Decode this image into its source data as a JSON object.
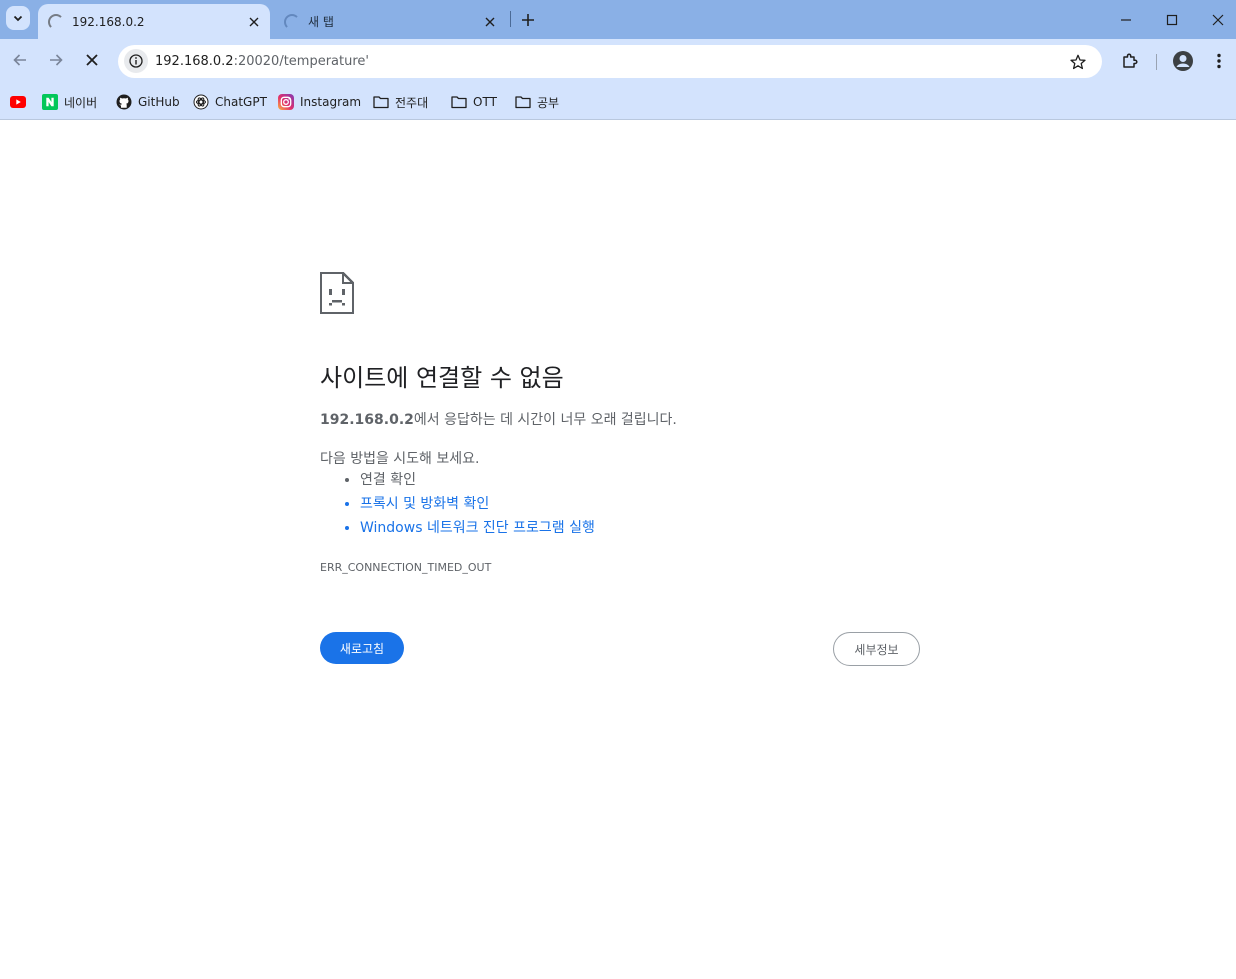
{
  "tabs": [
    {
      "title": "192.168.0.2",
      "active": true
    },
    {
      "title": "새 탭",
      "active": false
    }
  ],
  "toolbar": {
    "url_host": "192.168.0.2",
    "url_rest": ":20020/temperature'"
  },
  "bookmarks": [
    {
      "label": "",
      "icon": "youtube-icon"
    },
    {
      "label": "네이버",
      "icon": "naver-icon"
    },
    {
      "label": "GitHub",
      "icon": "github-icon"
    },
    {
      "label": "ChatGPT",
      "icon": "chatgpt-icon"
    },
    {
      "label": "Instagram",
      "icon": "instagram-icon"
    },
    {
      "label": "전주대",
      "icon": "folder-icon"
    },
    {
      "label": "OTT",
      "icon": "folder-icon"
    },
    {
      "label": "공부",
      "icon": "folder-icon"
    }
  ],
  "error": {
    "title": "사이트에 연결할 수 없음",
    "summary_host": "192.168.0.2",
    "summary_text": "에서 응답하는 데 시간이 너무 오래 걸립니다.",
    "suggest_head": "다음 방법을 시도해 보세요.",
    "suggestions": [
      {
        "text": "연결 확인",
        "link": false
      },
      {
        "text": "프록시 및 방화벽 확인",
        "link": true
      },
      {
        "text": "Windows 네트워크 진단 프로그램 실행",
        "link": true
      }
    ],
    "code": "ERR_CONNECTION_TIMED_OUT",
    "reload_label": "새로고침",
    "details_label": "세부정보"
  },
  "colors": {
    "tabstrip": "#8ab0e6",
    "toolbar": "#d3e3fd",
    "primary_button": "#1a73e8",
    "link": "#1a73e8"
  }
}
